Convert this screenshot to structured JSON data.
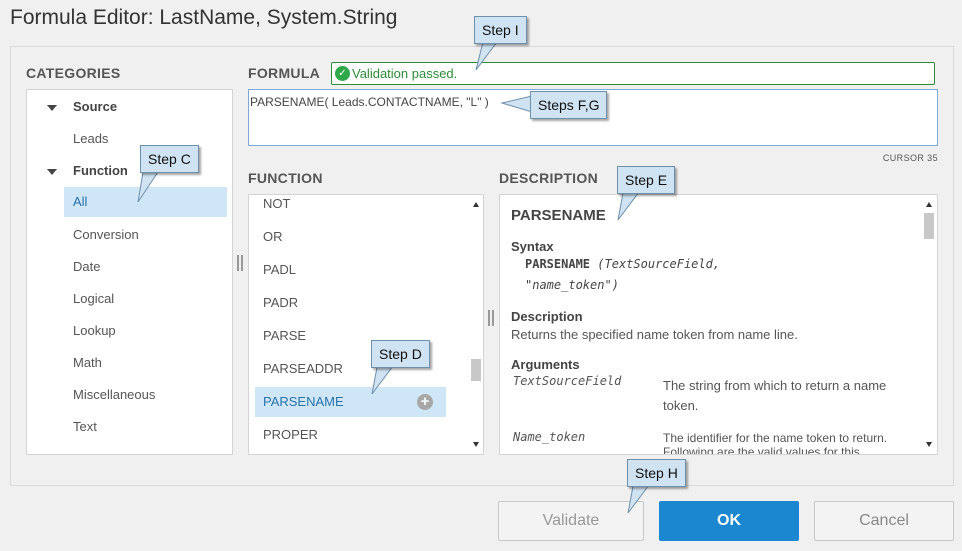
{
  "window": {
    "title": "Formula Editor: LastName, System.String"
  },
  "categories": {
    "label": "CATEGORIES",
    "tree": [
      {
        "label": "Source",
        "bold": true,
        "expanded": true
      },
      {
        "label": "Leads"
      },
      {
        "label": "Function",
        "bold": true,
        "expanded": true
      },
      {
        "label": "All",
        "selected": true
      },
      {
        "label": "Conversion"
      },
      {
        "label": "Date"
      },
      {
        "label": "Logical"
      },
      {
        "label": "Lookup"
      },
      {
        "label": "Math"
      },
      {
        "label": "Miscellaneous"
      },
      {
        "label": "Text"
      }
    ]
  },
  "formula": {
    "label": "FORMULA",
    "validation_message": "Validation passed.",
    "expression": "PARSENAME( Leads.CONTACTNAME, \"L\" )",
    "cursor_label": "CURSOR 35"
  },
  "functions": {
    "label": "FUNCTION",
    "items": [
      "NOT",
      "OR",
      "PADL",
      "PADR",
      "PARSE",
      "PARSEADDR",
      "PARSENAME",
      "PROPER"
    ],
    "selected": "PARSENAME",
    "add_icon": "+"
  },
  "description": {
    "label": "DESCRIPTION",
    "title": "PARSENAME",
    "syntax_heading": "Syntax",
    "syntax_name": "PARSENAME",
    "syntax_args_line1": "(TextSourceField,",
    "syntax_args_line2": "\"name_token\")",
    "description_heading": "Description",
    "description_text": "Returns the specified name token from name line.",
    "arguments_heading": "Arguments",
    "arguments": [
      {
        "name": "TextSourceField",
        "desc_line1": "The string from which to return a name",
        "desc_line2": "token."
      },
      {
        "name": "Name_token",
        "desc_line1": "The identifier for the name token to return.",
        "desc_line2": "Following are the valid values for this"
      }
    ]
  },
  "buttons": {
    "validate": "Validate",
    "ok": "OK",
    "cancel": "Cancel"
  },
  "callouts": {
    "step_i": "Step I",
    "steps_fg": "Steps F,G",
    "step_c": "Step C",
    "step_e": "Step E",
    "step_d": "Step D",
    "step_h": "Step H"
  },
  "colors": {
    "accent": "#1a87d0",
    "selection": "#cfe6f6",
    "success": "#2e8b3a",
    "callout": "#cfe3f3"
  }
}
